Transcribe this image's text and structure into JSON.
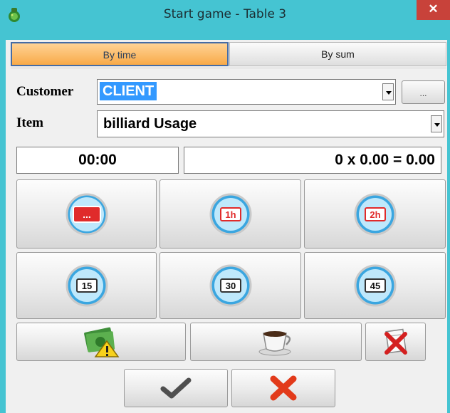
{
  "window": {
    "title": "Start game - Table 3",
    "close_glyph": "✕"
  },
  "tabs": {
    "by_time": "By time",
    "by_sum": "By sum",
    "active": "by_time"
  },
  "customer": {
    "label": "Customer",
    "value": "CLIENT",
    "browse_button": "..."
  },
  "item": {
    "label": "Item",
    "value": "billiard Usage"
  },
  "display": {
    "time": "00:00",
    "calc": "0 x 0.00 = 0.00"
  },
  "timer_buttons": [
    {
      "icon": "custom-time-clock-icon",
      "badge": "..."
    },
    {
      "icon": "one-hour-clock-icon",
      "badge": "1h"
    },
    {
      "icon": "two-hour-clock-icon",
      "badge": "2h"
    },
    {
      "icon": "fifteen-minute-clock-icon",
      "badge": "15"
    },
    {
      "icon": "thirty-minute-clock-icon",
      "badge": "30"
    },
    {
      "icon": "forty-five-minute-clock-icon",
      "badge": "45"
    }
  ],
  "action_buttons": [
    {
      "icon": "money-warning-icon"
    },
    {
      "icon": "coffee-cup-icon"
    },
    {
      "icon": "cancel-document-icon"
    }
  ],
  "dialog_buttons": [
    {
      "icon": "checkmark-icon"
    },
    {
      "icon": "red-x-icon"
    }
  ],
  "colors": {
    "titlebar": "#45c4d2",
    "close_button": "#c8423a",
    "active_tab": "#f8aa49",
    "selection": "#3399ff",
    "clock_blue": "#3aa6e0",
    "clock_red": "#e02b2b"
  }
}
